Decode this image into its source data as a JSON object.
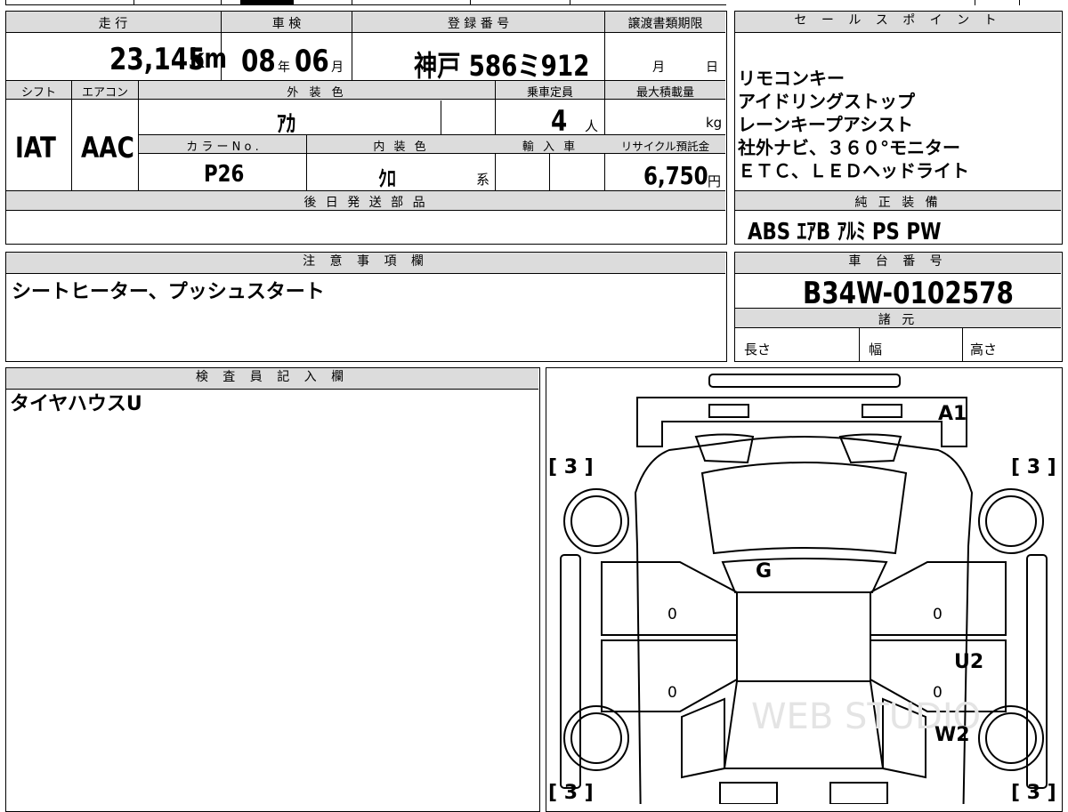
{
  "vehicle": {
    "mileage_label": "走 行",
    "mileage_value": "23,145",
    "mileage_unit": "km",
    "inspection_label": "車 検",
    "inspection_year": "08",
    "inspection_year_unit": "年",
    "inspection_month": "06",
    "inspection_month_unit": "月",
    "registration_label": "登 録 番 号",
    "registration_value": "神戸 586ミ912",
    "transfer_deadline_label": "譲渡書類期限",
    "transfer_month_unit": "月",
    "transfer_day_unit": "日",
    "shift_label": "シフト",
    "shift_value": "IAT",
    "aircon_label": "エアコン",
    "aircon_value": "AAC",
    "exterior_label": "外 装 色",
    "exterior_value": "ｱｶ",
    "capacity_label": "乗車定員",
    "capacity_value": "4",
    "capacity_unit": "人",
    "max_load_label": "最大積載量",
    "max_load_unit": "kg",
    "color_no_label": "カ ラ ー  N o .",
    "color_no_value": "P26",
    "interior_label": "内 装 色",
    "interior_value": "ｸﾛ",
    "interior_unit": "系",
    "import_label": "輸 入 車",
    "recycle_label": "リサイクル預託金",
    "recycle_value": "6,750",
    "recycle_unit": "円",
    "later_parts_label": "後 日 発 送 部 品"
  },
  "sales_points": {
    "title": "セ ー ル ス ポ イ ン ト",
    "lines": [
      "リモコンキー",
      "アイドリングストップ",
      "レーンキープアシスト",
      "社外ナビ、３６０°モニター",
      "ＥＴＣ、ＬＥＤヘッドライト"
    ]
  },
  "genuine_equipment": {
    "title": "純 正 装 備",
    "value": "ABS ｴｱB ｱﾙﾐ PS PW"
  },
  "notes": {
    "title": "注 意 事 項 欄",
    "text": "シートヒーター、プッシュスタート"
  },
  "chassis": {
    "title": "車 台 番 号",
    "value": "B34W-0102578",
    "specs_title": "諸 元",
    "length_label": "長さ",
    "width_label": "幅",
    "height_label": "高さ"
  },
  "inspector": {
    "title": "検 査 員 記 入 欄",
    "text": "タイヤハウスU"
  },
  "diagram": {
    "tire_front_left": "[ 3 ]",
    "tire_front_right": "[ 3 ]",
    "tire_rear_left": "[ 3 ]",
    "tire_rear_right": "[ 3 ]",
    "mark_a1": "A1",
    "mark_g": "G",
    "mark_u2": "U2",
    "mark_w2": "W2",
    "door_left_front": "0",
    "door_left_rear": "0",
    "door_right_front": "0",
    "door_right_rear": "0",
    "watermark": "WEB STUDIO"
  }
}
